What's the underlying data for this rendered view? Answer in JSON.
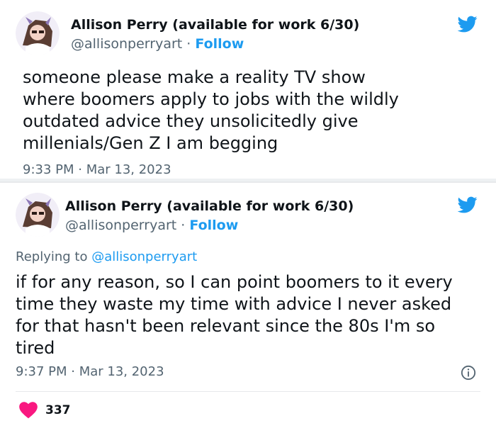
{
  "tweets": [
    {
      "display_name": "Allison Perry (available for work 6/30)",
      "handle": "@allisonperryart",
      "separator": "·",
      "follow_label": "Follow",
      "lines": [
        "someone please make a reality TV show",
        "where boomers apply to jobs with the wildly",
        "outdated advice they unsolicitedly give",
        "millenials/Gen Z I am begging"
      ],
      "timestamp": "9:33 PM · Mar 13, 2023"
    },
    {
      "display_name": "Allison Perry (available for work 6/30)",
      "handle": "@allisonperryart",
      "separator": "·",
      "follow_label": "Follow",
      "reply_prefix": "Replying to",
      "reply_handle": "@allisonperryart",
      "lines": [
        "if for any reason, so I can point boomers to it every",
        "time they waste my time with advice I never asked",
        "for that hasn't been relevant since the 80s I'm so",
        "tired"
      ],
      "timestamp": "9:37 PM · Mar 13, 2023",
      "likes": "337"
    }
  ],
  "colors": {
    "twitter_blue": "#1d9bf0",
    "text_primary": "#0f1419",
    "text_secondary": "#536471",
    "like_red": "#f91880"
  },
  "icons": {
    "logo": "twitter-bird-icon",
    "info": "info-circle-icon",
    "like": "heart-icon"
  }
}
